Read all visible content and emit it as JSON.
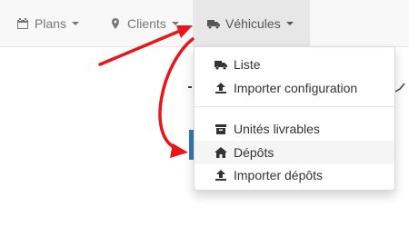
{
  "navbar": {
    "items": [
      {
        "label": "Plans",
        "icon": "calendar-icon"
      },
      {
        "label": "Clients",
        "icon": "map-marker-icon"
      },
      {
        "label": "Véhicules",
        "icon": "truck-icon",
        "active": true
      }
    ]
  },
  "dropdown": {
    "items": [
      {
        "label": "Liste",
        "icon": "truck-icon"
      },
      {
        "label": "Importer configuration",
        "icon": "upload-icon"
      },
      {
        "label": "Unités livrables",
        "icon": "archive-icon"
      },
      {
        "label": "Dépôts",
        "icon": "home-icon",
        "hovered": true
      },
      {
        "label": "Importer dépôts",
        "icon": "upload-icon"
      }
    ]
  },
  "annotations": {
    "arrow_color": "#e8151b"
  },
  "colors": {
    "navbar_bg": "#f8f8f8",
    "active_nav_bg": "#e7e7e7",
    "nav_text": "#777777",
    "menu_text": "#333333",
    "hover_bg": "#f5f5f5",
    "side_accent": "#337ab7"
  }
}
